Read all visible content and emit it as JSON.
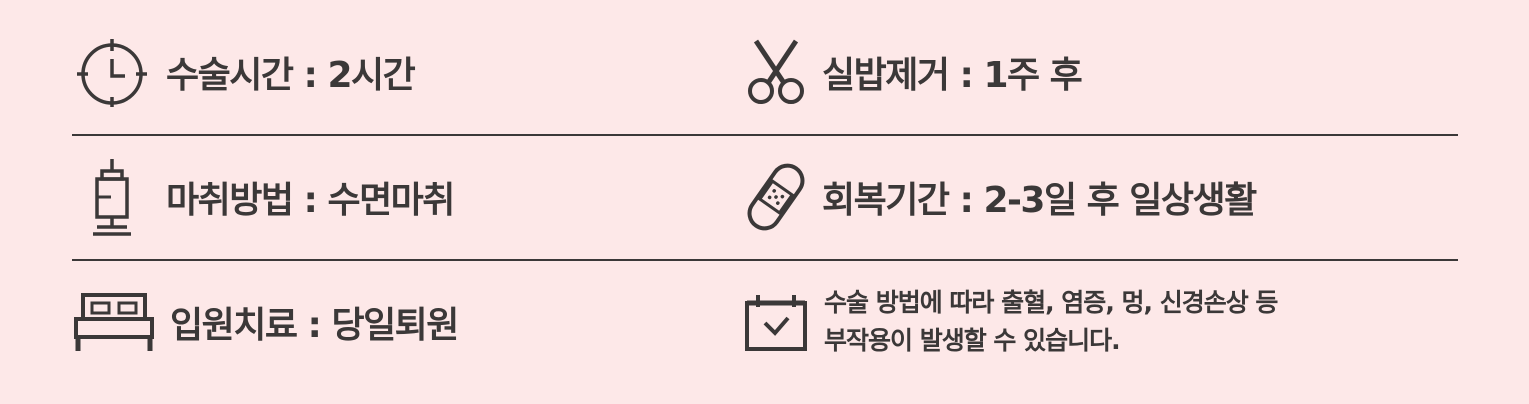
{
  "colors": {
    "background": "#fde8e8",
    "text": "#3b3838",
    "divider": "#3b3838"
  },
  "items": [
    {
      "icon": "clock-icon",
      "text": "수술시간 : 2시간"
    },
    {
      "icon": "scissors-icon",
      "text": "실밥제거 : 1주 후"
    },
    {
      "icon": "syringe-icon",
      "text": "마취방법 : 수면마취"
    },
    {
      "icon": "bandage-icon",
      "text": "회복기간 : 2-3일 후 일상생활"
    },
    {
      "icon": "bed-icon",
      "text": "입원치료 : 당일퇴원"
    }
  ],
  "notice": {
    "icon": "calendar-check-icon",
    "line1": "수술 방법에 따라 출혈, 염증, 멍, 신경손상 등",
    "line2": "부작용이 발생할 수 있습니다."
  }
}
